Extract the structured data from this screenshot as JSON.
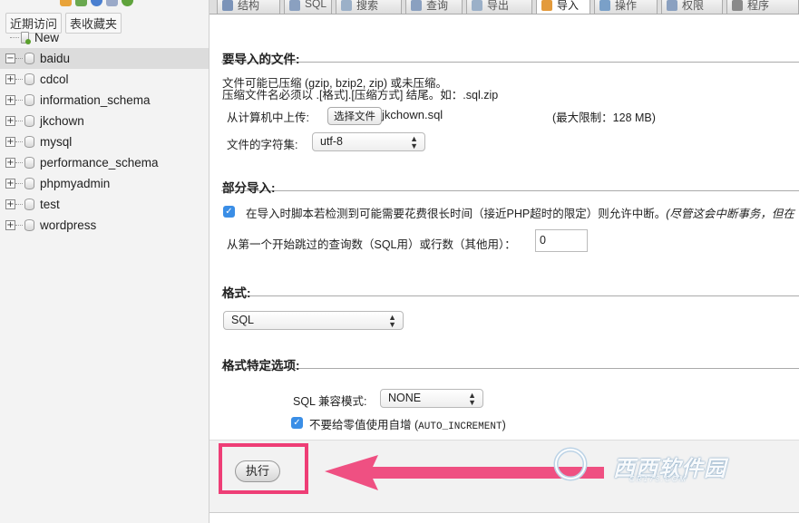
{
  "sidebar": {
    "tabs": [
      "近期访问",
      "表收藏夹"
    ],
    "tree": [
      {
        "label": "New",
        "kind": "new",
        "selected": false
      },
      {
        "label": "baidu",
        "kind": "db",
        "selected": true
      },
      {
        "label": "cdcol",
        "kind": "db",
        "selected": false
      },
      {
        "label": "information_schema",
        "kind": "db",
        "selected": false
      },
      {
        "label": "jkchown",
        "kind": "db",
        "selected": false
      },
      {
        "label": "mysql",
        "kind": "db",
        "selected": false
      },
      {
        "label": "performance_schema",
        "kind": "db",
        "selected": false
      },
      {
        "label": "phpmyadmin",
        "kind": "db",
        "selected": false
      },
      {
        "label": "test",
        "kind": "db",
        "selected": false
      },
      {
        "label": "wordpress",
        "kind": "db",
        "selected": false
      }
    ],
    "expander_collapsed": "+",
    "expander_expanded": "−"
  },
  "tabs": [
    {
      "label": "结构",
      "active": false
    },
    {
      "label": "SQL",
      "active": false
    },
    {
      "label": "搜索",
      "active": false
    },
    {
      "label": "查询",
      "active": false
    },
    {
      "label": "导出",
      "active": false
    },
    {
      "label": "导入",
      "active": true
    },
    {
      "label": "操作",
      "active": false
    },
    {
      "label": "权限",
      "active": false
    },
    {
      "label": "程序",
      "active": false
    }
  ],
  "file_section": {
    "legend": "要导入的文件:",
    "line1": "文件可能已压缩 (gzip, bzip2, zip) 或未压缩。",
    "line2": "压缩文件名必须以 .[格式].[压缩方式] 结尾。如：.sql.zip",
    "upload_label": "从计算机中上传:",
    "choose_button": "选择文件",
    "file_name": "jkchown.sql",
    "max_limit": "(最大限制：128 MB)",
    "charset_label": "文件的字符集:",
    "charset_value": "utf-8"
  },
  "partial_section": {
    "legend": "部分导入:",
    "allow_interrupt_text": "在导入时脚本若检测到可能需要花费很长时间（接近PHP超时的限定）则允许中断。",
    "allow_interrupt_note": "(尽管这会中断事务，但在",
    "allow_interrupt_checked": true,
    "skip_label": "从第一个开始跳过的查询数（SQL用）或行数（其他用）：",
    "skip_value": "0"
  },
  "format_section": {
    "legend": "格式:",
    "format_value": "SQL"
  },
  "options_section": {
    "legend": "格式特定选项:",
    "compat_label": "SQL 兼容模式:",
    "compat_value": "NONE",
    "no_auto_value_prefix": "不要给零值使用自增 (",
    "no_auto_value_code": "AUTO_INCREMENT",
    "no_auto_value_suffix": ")",
    "no_auto_value_checked": true
  },
  "footer": {
    "execute_button": "执行"
  },
  "check_glyph": "✓",
  "select_arrows": "▲▼",
  "watermark": {
    "main": "西西软件园",
    "sub": "CR173.COM"
  },
  "colors": {
    "highlight": "#ee3e76",
    "checkbox": "#3a8ee6"
  }
}
